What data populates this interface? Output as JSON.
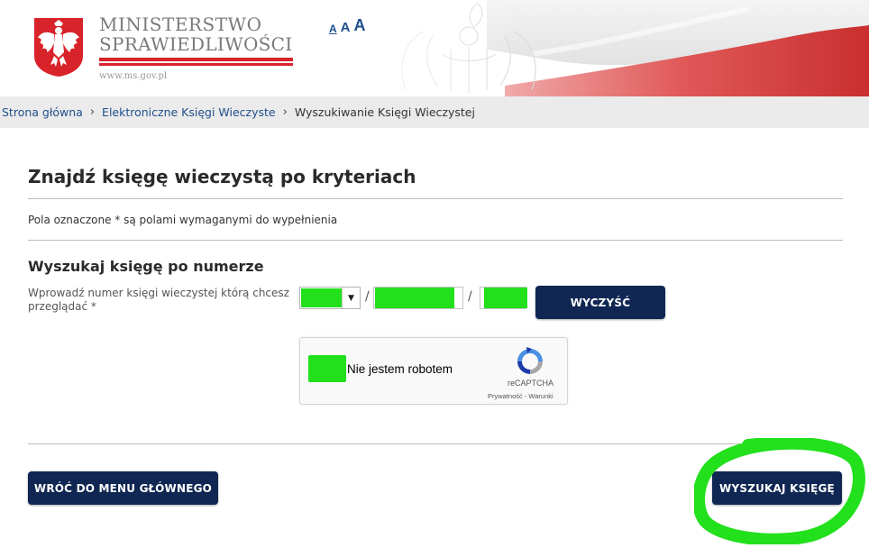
{
  "header": {
    "ministry_line1": "MINISTERSTWO",
    "ministry_line2": "SPRAWIEDLIWOŚCI",
    "ministry_url": "www.ms.gov.pl",
    "font_size_options": [
      "A",
      "A",
      "A"
    ]
  },
  "breadcrumb": {
    "items": [
      {
        "label": "Strona główna"
      },
      {
        "label": "Elektroniczne Księgi Wieczyste"
      }
    ],
    "current": "Wyszukiwanie Księgi Wieczystej"
  },
  "main": {
    "title": "Znajdź księgę wieczystą po kryteriach",
    "required_note": "Pola oznaczone * są polami wymaganymi do wypełnienia",
    "section_title": "Wyszukaj księgę po numerze",
    "field_label": "Wprowadź numer księgi wieczystej którą chcesz przeglądać *",
    "slash_1": "/",
    "slash_2": "/",
    "clear_button": "WYCZYŚĆ",
    "captcha": {
      "label": "Nie jestem robotem",
      "brand": "reCAPTCHA",
      "terms": "Prywatność - Warunki"
    },
    "back_button": "WRÓĆ DO MENU GŁÓWNEGO",
    "search_button": "WYSZUKAJ KSIĘGĘ"
  },
  "colors": {
    "button_bg": "#0f2752",
    "link": "#1f4e8c",
    "redaction_green": "#22e01c",
    "flag_red": "#dc3b3b"
  }
}
